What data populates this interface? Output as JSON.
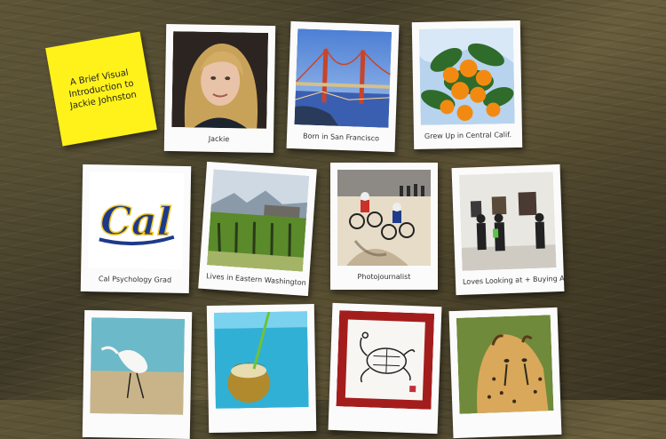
{
  "note": {
    "text": "A Brief Visual Introduction to Jackie Johnston"
  },
  "photos": [
    {
      "caption": "Jackie"
    },
    {
      "caption": "Born in San Francisco"
    },
    {
      "caption": "Grew Up in Central Calif."
    },
    {
      "caption": "Cal Psychology Grad"
    },
    {
      "caption": "Lives in Eastern Washington"
    },
    {
      "caption": "Photojournalist"
    },
    {
      "caption": "Loves Looking at + Buying Art"
    },
    {
      "caption": ""
    },
    {
      "caption": ""
    },
    {
      "caption": ""
    },
    {
      "caption": ""
    }
  ],
  "logo": {
    "text": "Cal"
  },
  "colors": {
    "sticky": "#fff21a",
    "cal_blue": "#1d3a8a",
    "cal_gold": "#f3c623",
    "turtle_frame": "#a41d1d"
  }
}
